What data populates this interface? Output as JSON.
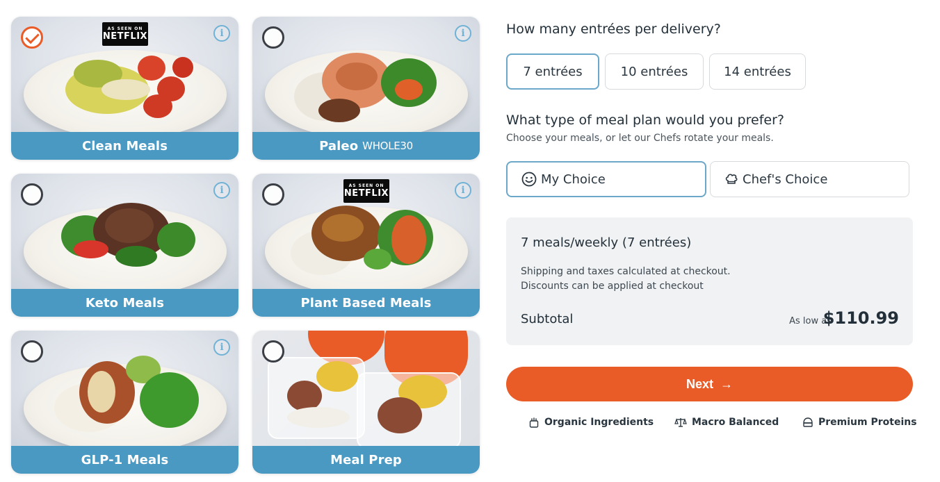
{
  "meal_plans": [
    {
      "label": "Clean Meals",
      "selected": true,
      "badge": "AS SEEN ON NETFLIX"
    },
    {
      "label": "Paleo",
      "suffix": "WHOLE30",
      "selected": false
    },
    {
      "label": "Keto Meals",
      "selected": false
    },
    {
      "label": "Plant Based Meals",
      "selected": false,
      "badge": "AS SEEN ON NETFLIX"
    },
    {
      "label": "GLP-1 Meals",
      "selected": false
    },
    {
      "label": "Meal Prep",
      "selected": false
    }
  ],
  "netflix_badge": {
    "top": "AS SEEN ON",
    "main": "NETFLIX"
  },
  "entrees": {
    "question": "How many entrées per delivery?",
    "options": [
      "7 entrées",
      "10 entrées",
      "14 entrées"
    ],
    "selected": "7 entrées"
  },
  "meal_plan_type": {
    "question": "What type of meal plan would you prefer?",
    "subtitle": "Choose your meals, or let our Chefs rotate your meals.",
    "options": [
      {
        "label": "My Choice",
        "icon": "smiley-icon"
      },
      {
        "label": "Chef's Choice",
        "icon": "chef-hat-icon"
      }
    ],
    "selected": "My Choice"
  },
  "summary": {
    "plan": "7 meals/weekly (7 entrées)",
    "note_1": "Shipping and taxes calculated at checkout.",
    "note_2": "Discounts can be applied at checkout",
    "subtotal_label": "Subtotal",
    "as_low_as": "As low as",
    "price": "$110.99"
  },
  "next_button": {
    "label": "Next",
    "icon": "arrow-right-icon"
  },
  "features": [
    {
      "label": "Organic Ingredients",
      "icon": "organic-icon"
    },
    {
      "label": "Macro Balanced",
      "icon": "scale-icon"
    },
    {
      "label": "Premium Proteins",
      "icon": "protein-icon"
    }
  ],
  "colors": {
    "accent": "#ea5c27",
    "band": "#4a99c3",
    "selected_border": "#6aa7c9",
    "summary_bg": "#f0f2f3"
  }
}
